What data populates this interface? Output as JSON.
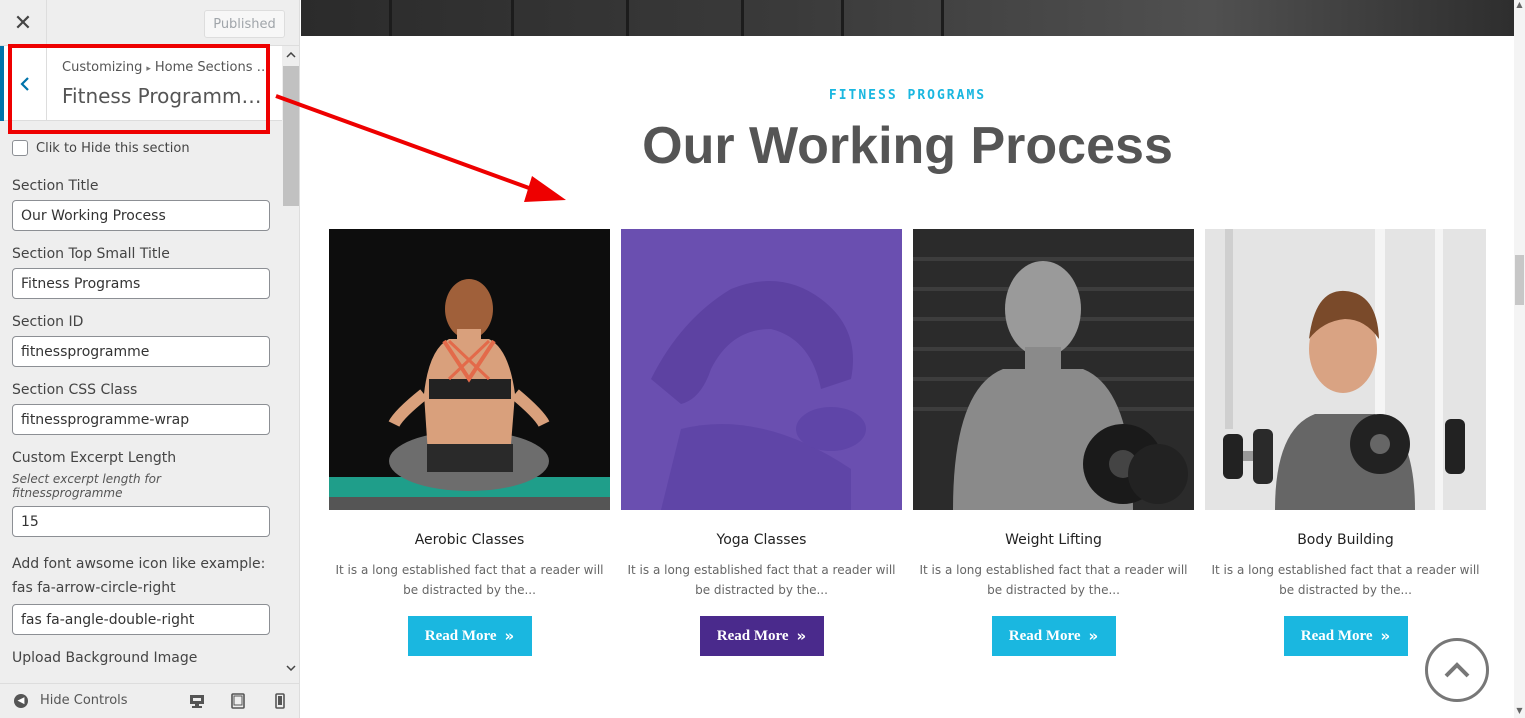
{
  "topbar": {
    "close_icon": "✕",
    "publish_label": "Published"
  },
  "section_header": {
    "back_icon": "‹",
    "crumb_root": "Customizing",
    "crumb_sep": "▸",
    "crumb_parent": "Home Sections S...",
    "section_name": "Fitness Programme Sec..."
  },
  "controls": {
    "hide_section_label": "Clik to Hide this section",
    "section_title_label": "Section Title",
    "section_title_value": "Our Working Process",
    "top_small_title_label": "Section Top Small Title",
    "top_small_title_value": "Fitness Programs",
    "section_id_label": "Section ID",
    "section_id_value": "fitnessprogramme",
    "css_class_label": "Section CSS Class",
    "css_class_value": "fitnessprogramme-wrap",
    "excerpt_label": "Custom Excerpt Length",
    "excerpt_desc": "Select excerpt length for fitnessprogramme",
    "excerpt_value": "15",
    "icon_label_line1": "Add font awsome icon like example:",
    "icon_label_line2": "fas fa-arrow-circle-right",
    "icon_value": "fas fa-angle-double-right",
    "bg_image_label": "Upload Background Image"
  },
  "footer": {
    "hide_controls_label": "Hide Controls"
  },
  "preview": {
    "eyebrow": "FITNESS PROGRAMS",
    "title": "Our Working Process",
    "cards": [
      {
        "title": "Aerobic Classes",
        "text": "It is a long established fact that a reader will be distracted by the...",
        "button": "Read More",
        "button_color": "#1ab7e0"
      },
      {
        "title": "Yoga Classes",
        "text": "It is a long established fact that a reader will be distracted by the...",
        "button": "Read More",
        "button_color": "#4a2a8c"
      },
      {
        "title": "Weight Lifting",
        "text": "It is a long established fact that a reader will be distracted by the...",
        "button": "Read More",
        "button_color": "#1ab7e0"
      },
      {
        "title": "Body Building",
        "text": "It is a long established fact that a reader will be distracted by the...",
        "button": "Read More",
        "button_color": "#1ab7e0"
      }
    ]
  },
  "colors": {
    "accent": "#1ab7e0",
    "accent_alt": "#4a2a8c",
    "highlight": "#e00000",
    "wp_blue": "#0073aa"
  }
}
